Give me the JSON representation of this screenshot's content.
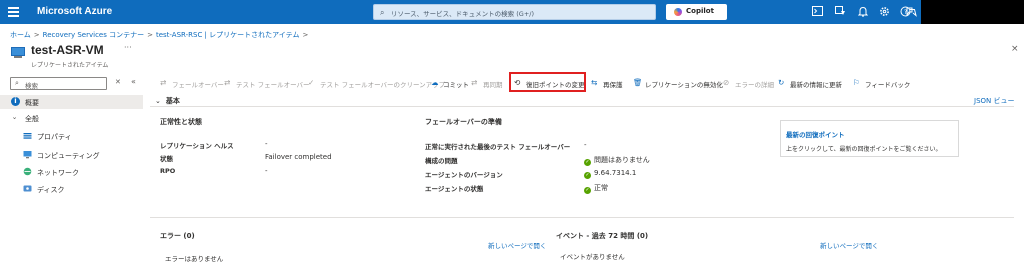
{
  "topbar": {
    "brand": "Microsoft Azure",
    "search_placeholder": "リソース、サービス、ドキュメントの検索 (G+/)",
    "copilot_label": "Copilot",
    "icons": [
      "terminal-icon",
      "directory-filter-icon",
      "bell-icon",
      "gear-icon",
      "help-icon",
      "feedback-icon"
    ]
  },
  "breadcrumb": [
    "ホーム",
    "Recovery Services コンテナー",
    "test-ASR-RSC | レプリケートされたアイテム"
  ],
  "page": {
    "title": "test-ASR-VM",
    "more": "···",
    "subtitle": "レプリケートされたアイテム",
    "close": "×"
  },
  "nav": {
    "search_placeholder": "検索",
    "items": [
      {
        "label": "概要",
        "icon": "info-icon",
        "active": true
      },
      {
        "label": "全般",
        "icon": "chevron-down-icon",
        "group": true
      },
      {
        "label": "プロパティ",
        "icon": "properties-icon"
      },
      {
        "label": "コンピューティング",
        "icon": "compute-icon"
      },
      {
        "label": "ネットワーク",
        "icon": "network-icon"
      },
      {
        "label": "ディスク",
        "icon": "disk-icon"
      }
    ]
  },
  "toolbar": {
    "failover": "フェールオーバー",
    "test_failover": "テスト フェールオーバー",
    "test_failover_cleanup": "テスト フェールオーバーのクリーンアップ",
    "commit": "コミット",
    "resync": "再同期",
    "change_recovery_point": "復旧ポイントの変更",
    "reprotect": "再保護",
    "disable_replication": "レプリケーションの無効化",
    "error_details": "エラーの詳細",
    "refresh": "最新の情報に更新",
    "feedback": "フィードバック"
  },
  "essentials": {
    "header": "基本",
    "json_view": "JSON ビュー",
    "health": {
      "title": "正常性と状態",
      "rows": [
        {
          "key": "レプリケーション ヘルス",
          "value": "-"
        },
        {
          "key": "状態",
          "value": "Failover completed"
        },
        {
          "key": "RPO",
          "value": "-"
        }
      ]
    },
    "failover_readiness": {
      "title": "フェールオーバーの準備",
      "rows": [
        {
          "key": "正常に実行された最後のテスト フェールオーバー",
          "value": "-"
        },
        {
          "key": "構成の問題",
          "value": "問題はありません",
          "ok": true
        },
        {
          "key": "エージェントのバージョン",
          "value": "9.64.7314.1",
          "ok": true
        },
        {
          "key": "エージェントの状態",
          "value": "正常",
          "ok": true
        }
      ]
    },
    "recovery_point": {
      "title": "最新の回復ポイント",
      "desc": "上をクリックして、最新の回復ポイントをご覧ください。"
    }
  },
  "errors": {
    "title": "エラー (0)",
    "open_new": "新しいページで開く",
    "empty": "エラーはありません"
  },
  "events": {
    "title": "イベント - 過去 72 時間 (0)",
    "open_new": "新しいページで開く",
    "empty": "イベントがありません"
  },
  "colors": {
    "accent": "#0f6cbd",
    "highlight": "#e02020",
    "ok": "#57a300"
  }
}
